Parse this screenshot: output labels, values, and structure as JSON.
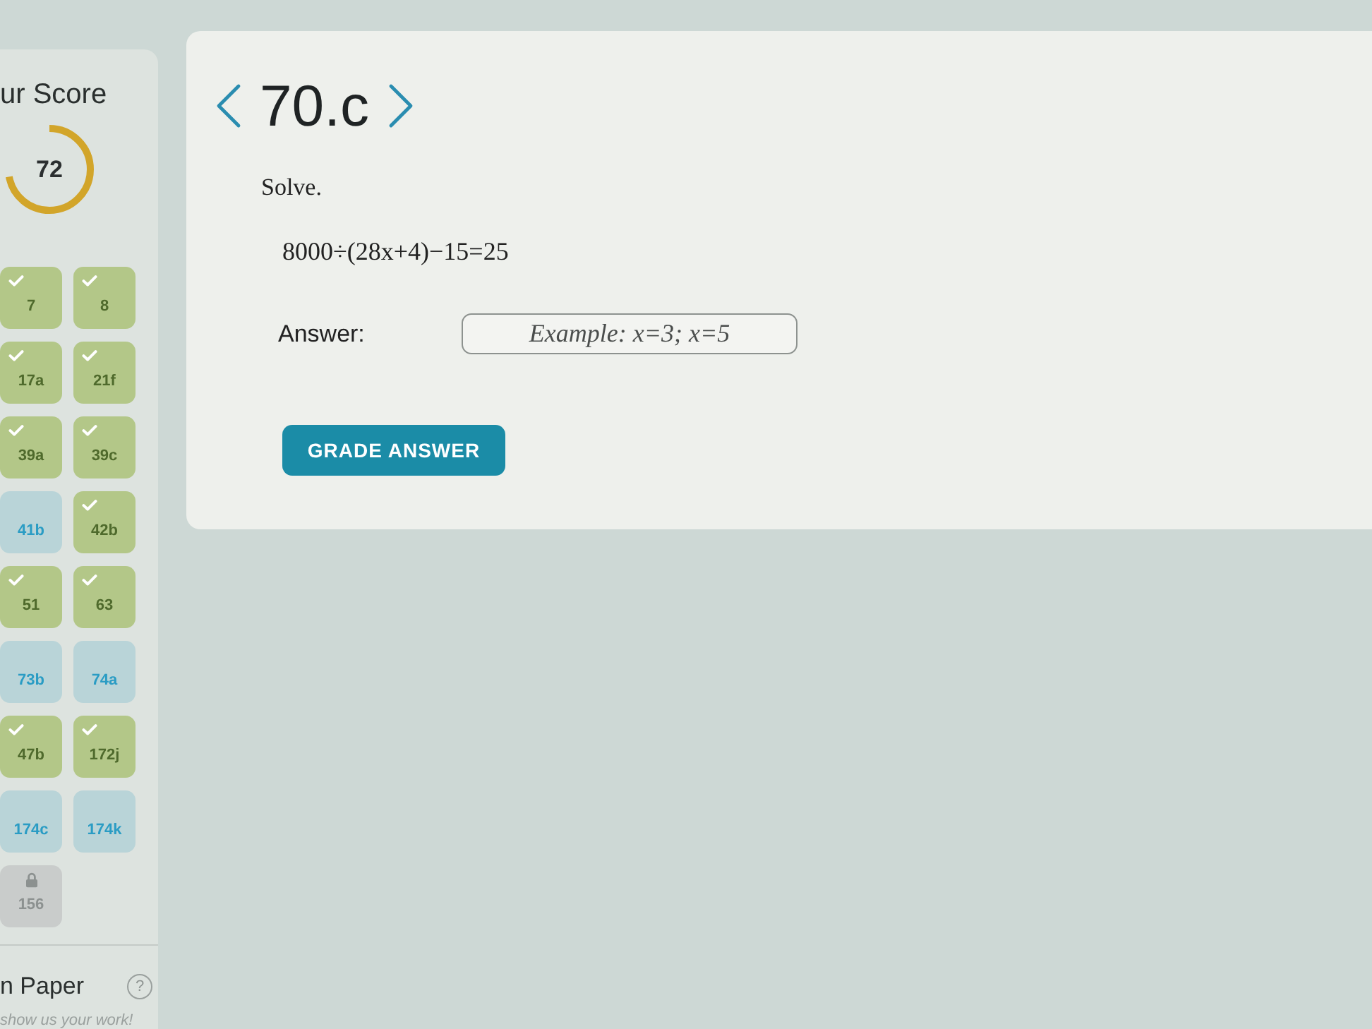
{
  "sidebar": {
    "score_title": "ur Score",
    "score": {
      "value": "72",
      "level": 0.72
    },
    "problems": [
      {
        "label": "7",
        "kind": "correct"
      },
      {
        "label": "8",
        "kind": "correct"
      },
      {
        "label": "17a",
        "kind": "correct"
      },
      {
        "label": "21f",
        "kind": "correct"
      },
      {
        "label": "39a",
        "kind": "correct"
      },
      {
        "label": "39c",
        "kind": "correct"
      },
      {
        "label": "41b",
        "kind": "open"
      },
      {
        "label": "42b",
        "kind": "correct"
      },
      {
        "label": "51",
        "kind": "correct"
      },
      {
        "label": "63",
        "kind": "correct"
      },
      {
        "label": "73b",
        "kind": "open"
      },
      {
        "label": "74a",
        "kind": "open"
      },
      {
        "label": "47b",
        "kind": "correct"
      },
      {
        "label": "172j",
        "kind": "correct"
      },
      {
        "label": "174c",
        "kind": "open"
      },
      {
        "label": "174k",
        "kind": "open"
      },
      {
        "label": "156",
        "kind": "locked"
      }
    ],
    "paper": {
      "title": "n Paper",
      "help": "?",
      "hint": "show us your work!"
    }
  },
  "problem": {
    "title": "70.c",
    "prompt": "Solve.",
    "equation": "8000÷(28x+4)−15=25",
    "answer": {
      "label": "Answer:",
      "placeholder": "Example: x=3; x=5"
    },
    "button": "GRADE ANSWER"
  }
}
